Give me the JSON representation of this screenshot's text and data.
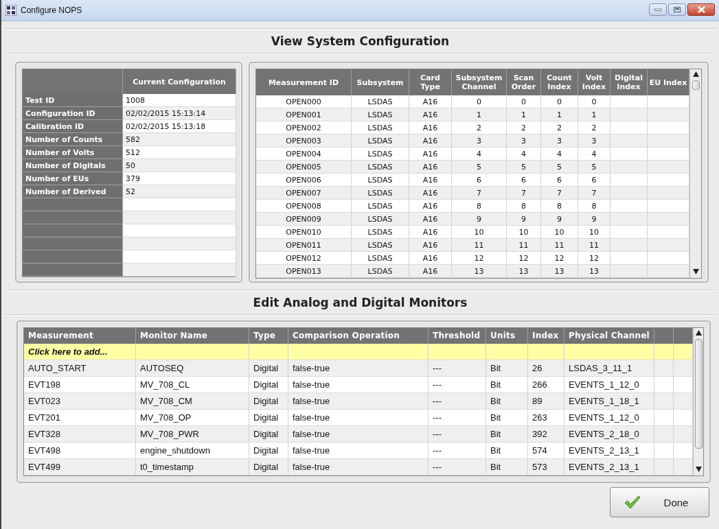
{
  "window": {
    "title": "Configure NOPS"
  },
  "system_section": {
    "heading": "View System Configuration"
  },
  "configuration": {
    "columns": [
      "Current Configuration"
    ],
    "rows": [
      {
        "label": "Test ID",
        "value": "1008"
      },
      {
        "label": "Configuration ID",
        "value": "02/02/2015 15:13:14"
      },
      {
        "label": "Calibration ID",
        "value": "02/02/2015 15:13:18"
      },
      {
        "label": "Number of Counts",
        "value": "582"
      },
      {
        "label": "Number of Volts",
        "value": "512"
      },
      {
        "label": "Number of Digitals",
        "value": "50"
      },
      {
        "label": "Number of EUs",
        "value": "379"
      },
      {
        "label": "Number of Derived",
        "value": "52"
      }
    ]
  },
  "measurements": {
    "columns": [
      "Measurement ID",
      "Subsystem",
      "Card Type",
      "Subsystem Channel",
      "Scan Order",
      "Count Index",
      "Volt Index",
      "Digital Index",
      "EU Index"
    ],
    "rows": [
      [
        "OPEN000",
        "LSDAS",
        "A16",
        "0",
        "0",
        "0",
        "0"
      ],
      [
        "OPEN001",
        "LSDAS",
        "A16",
        "1",
        "1",
        "1",
        "1"
      ],
      [
        "OPEN002",
        "LSDAS",
        "A16",
        "2",
        "2",
        "2",
        "2"
      ],
      [
        "OPEN003",
        "LSDAS",
        "A16",
        "3",
        "3",
        "3",
        "3"
      ],
      [
        "OPEN004",
        "LSDAS",
        "A16",
        "4",
        "4",
        "4",
        "4"
      ],
      [
        "OPEN005",
        "LSDAS",
        "A16",
        "5",
        "5",
        "5",
        "5"
      ],
      [
        "OPEN006",
        "LSDAS",
        "A16",
        "6",
        "6",
        "6",
        "6"
      ],
      [
        "OPEN007",
        "LSDAS",
        "A16",
        "7",
        "7",
        "7",
        "7"
      ],
      [
        "OPEN008",
        "LSDAS",
        "A16",
        "8",
        "8",
        "8",
        "8"
      ],
      [
        "OPEN009",
        "LSDAS",
        "A16",
        "9",
        "9",
        "9",
        "9"
      ],
      [
        "OPEN010",
        "LSDAS",
        "A16",
        "10",
        "10",
        "10",
        "10"
      ],
      [
        "OPEN011",
        "LSDAS",
        "A16",
        "11",
        "11",
        "11",
        "11"
      ],
      [
        "OPEN012",
        "LSDAS",
        "A16",
        "12",
        "12",
        "12",
        "12"
      ],
      [
        "OPEN013",
        "LSDAS",
        "A16",
        "13",
        "13",
        "13",
        "13"
      ]
    ]
  },
  "monitors_section": {
    "heading": "Edit Analog and Digital Monitors"
  },
  "monitors": {
    "columns": [
      "Measurement",
      "Monitor Name",
      "Type",
      "Comparison Operation",
      "Threshold",
      "Units",
      "Index",
      "Physical Channel"
    ],
    "add_row": {
      "placeholder": "Click here to add..."
    },
    "rows": [
      [
        "AUTO_START",
        "AUTOSEQ",
        "Digital",
        "false-true",
        "---",
        "Bit",
        "26",
        "LSDAS_3_11_1"
      ],
      [
        "EVT198",
        "MV_708_CL",
        "Digital",
        "false-true",
        "---",
        "Bit",
        "266",
        "EVENTS_1_12_0"
      ],
      [
        "EVT023",
        "MV_708_CM",
        "Digital",
        "false-true",
        "---",
        "Bit",
        "89",
        "EVENTS_1_18_1"
      ],
      [
        "EVT201",
        "MV_708_OP",
        "Digital",
        "false-true",
        "---",
        "Bit",
        "263",
        "EVENTS_1_12_0"
      ],
      [
        "EVT328",
        "MV_708_PWR",
        "Digital",
        "false-true",
        "---",
        "Bit",
        "392",
        "EVENTS_2_18_0"
      ],
      [
        "EVT498",
        "engine_shutdown",
        "Digital",
        "false-true",
        "---",
        "Bit",
        "574",
        "EVENTS_2_13_1"
      ],
      [
        "EVT499",
        "t0_timestamp",
        "Digital",
        "false-true",
        "---",
        "Bit",
        "573",
        "EVENTS_2_13_1"
      ]
    ]
  },
  "done_button": {
    "label": "Done"
  }
}
